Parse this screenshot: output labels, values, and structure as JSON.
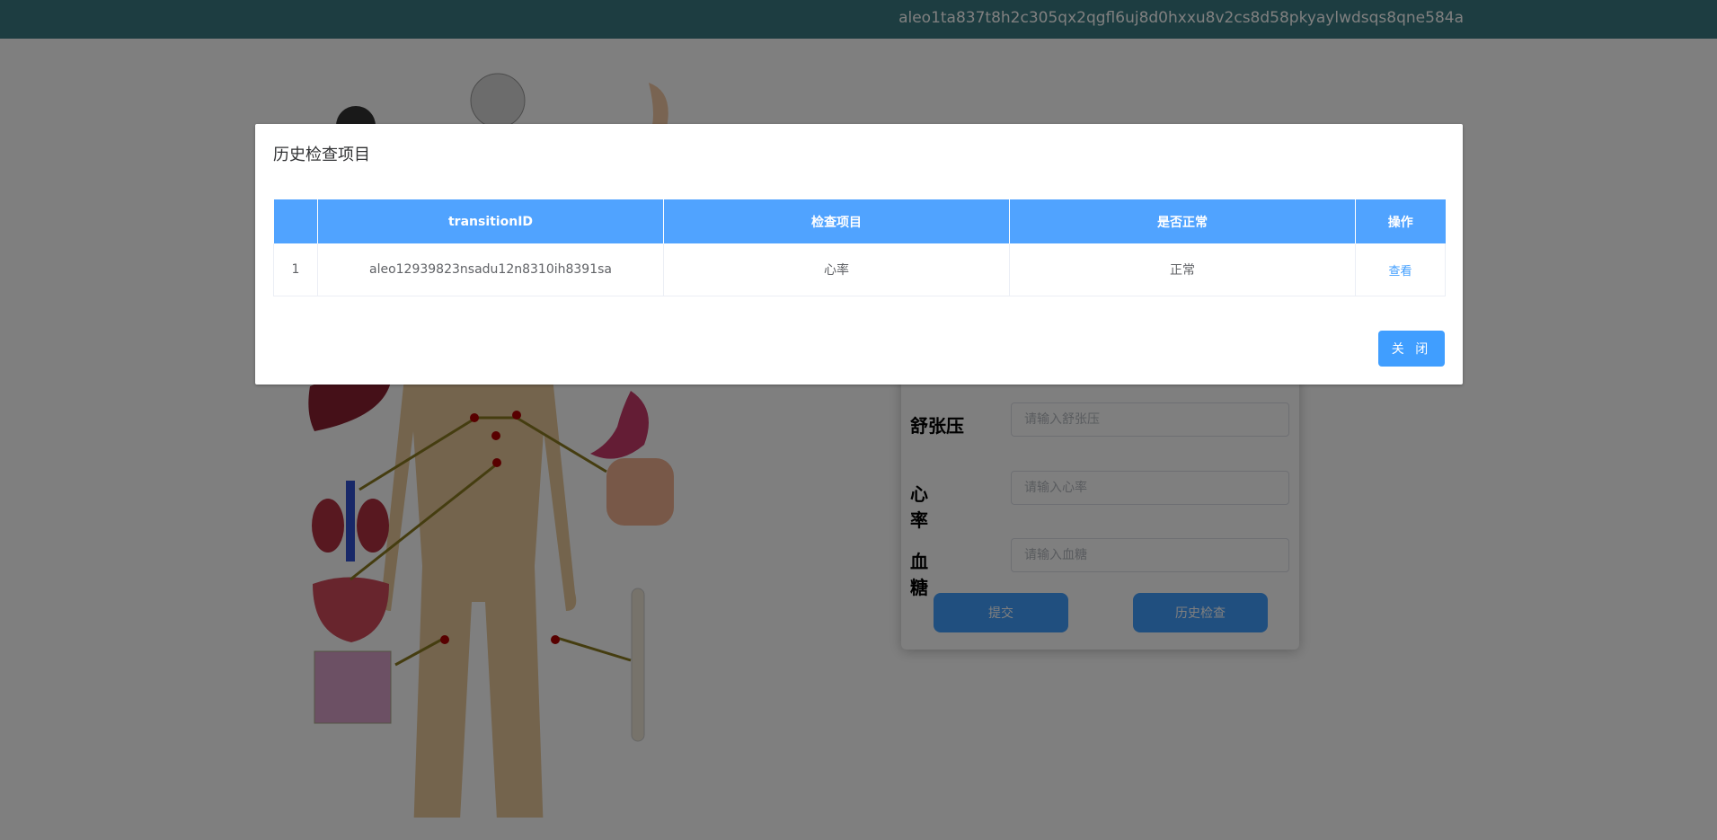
{
  "header": {
    "user_id": "aleo1ta837t8h2c305qx2qgfl6uj8d0hxxu8v2cs8d58pkyaylwdsqs8qne584a"
  },
  "form": {
    "fields": [
      {
        "label": "舒张压",
        "placeholder": "请输入舒张压"
      },
      {
        "label": "心率",
        "placeholder": "请输入心率"
      },
      {
        "label": "血糖",
        "placeholder": "请输入血糖"
      }
    ],
    "submit_label": "提交",
    "history_label": "历史检查"
  },
  "dialog": {
    "title": "历史检查项目",
    "columns": [
      "",
      "transitionID",
      "检查项目",
      "是否正常",
      "操作"
    ],
    "rows": [
      {
        "index": "1",
        "transition_id": "aleo12939823nsadu12n8310ih8391sa",
        "item": "心率",
        "normal": "正常",
        "action": "查看"
      }
    ],
    "close_label": "关 闭"
  },
  "colors": {
    "accent": "#409eff",
    "header_bg": "#3a7a82",
    "table_header": "#50a3ff"
  }
}
